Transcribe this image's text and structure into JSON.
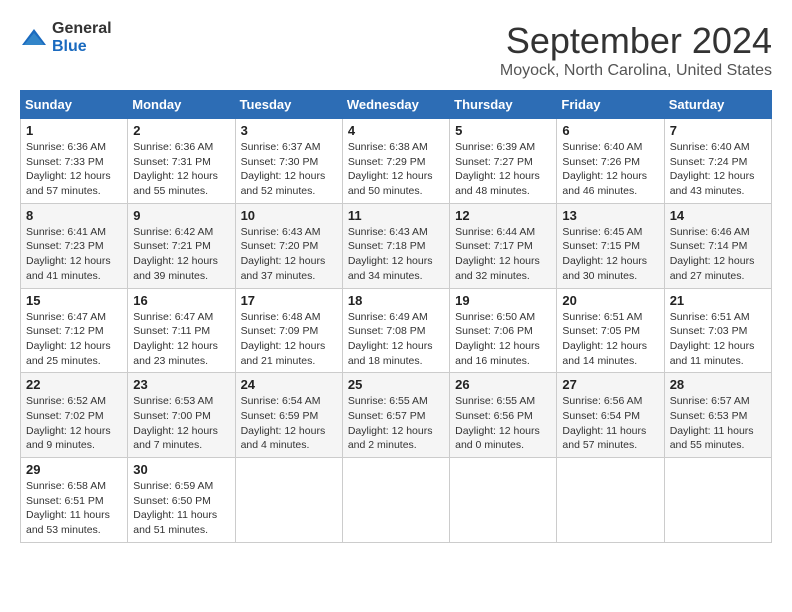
{
  "header": {
    "logo_general": "General",
    "logo_blue": "Blue",
    "month": "September 2024",
    "location": "Moyock, North Carolina, United States"
  },
  "weekdays": [
    "Sunday",
    "Monday",
    "Tuesday",
    "Wednesday",
    "Thursday",
    "Friday",
    "Saturday"
  ],
  "weeks": [
    [
      {
        "day": "1",
        "sunrise": "6:36 AM",
        "sunset": "7:33 PM",
        "daylight": "12 hours and 57 minutes."
      },
      {
        "day": "2",
        "sunrise": "6:36 AM",
        "sunset": "7:31 PM",
        "daylight": "12 hours and 55 minutes."
      },
      {
        "day": "3",
        "sunrise": "6:37 AM",
        "sunset": "7:30 PM",
        "daylight": "12 hours and 52 minutes."
      },
      {
        "day": "4",
        "sunrise": "6:38 AM",
        "sunset": "7:29 PM",
        "daylight": "12 hours and 50 minutes."
      },
      {
        "day": "5",
        "sunrise": "6:39 AM",
        "sunset": "7:27 PM",
        "daylight": "12 hours and 48 minutes."
      },
      {
        "day": "6",
        "sunrise": "6:40 AM",
        "sunset": "7:26 PM",
        "daylight": "12 hours and 46 minutes."
      },
      {
        "day": "7",
        "sunrise": "6:40 AM",
        "sunset": "7:24 PM",
        "daylight": "12 hours and 43 minutes."
      }
    ],
    [
      {
        "day": "8",
        "sunrise": "6:41 AM",
        "sunset": "7:23 PM",
        "daylight": "12 hours and 41 minutes."
      },
      {
        "day": "9",
        "sunrise": "6:42 AM",
        "sunset": "7:21 PM",
        "daylight": "12 hours and 39 minutes."
      },
      {
        "day": "10",
        "sunrise": "6:43 AM",
        "sunset": "7:20 PM",
        "daylight": "12 hours and 37 minutes."
      },
      {
        "day": "11",
        "sunrise": "6:43 AM",
        "sunset": "7:18 PM",
        "daylight": "12 hours and 34 minutes."
      },
      {
        "day": "12",
        "sunrise": "6:44 AM",
        "sunset": "7:17 PM",
        "daylight": "12 hours and 32 minutes."
      },
      {
        "day": "13",
        "sunrise": "6:45 AM",
        "sunset": "7:15 PM",
        "daylight": "12 hours and 30 minutes."
      },
      {
        "day": "14",
        "sunrise": "6:46 AM",
        "sunset": "7:14 PM",
        "daylight": "12 hours and 27 minutes."
      }
    ],
    [
      {
        "day": "15",
        "sunrise": "6:47 AM",
        "sunset": "7:12 PM",
        "daylight": "12 hours and 25 minutes."
      },
      {
        "day": "16",
        "sunrise": "6:47 AM",
        "sunset": "7:11 PM",
        "daylight": "12 hours and 23 minutes."
      },
      {
        "day": "17",
        "sunrise": "6:48 AM",
        "sunset": "7:09 PM",
        "daylight": "12 hours and 21 minutes."
      },
      {
        "day": "18",
        "sunrise": "6:49 AM",
        "sunset": "7:08 PM",
        "daylight": "12 hours and 18 minutes."
      },
      {
        "day": "19",
        "sunrise": "6:50 AM",
        "sunset": "7:06 PM",
        "daylight": "12 hours and 16 minutes."
      },
      {
        "day": "20",
        "sunrise": "6:51 AM",
        "sunset": "7:05 PM",
        "daylight": "12 hours and 14 minutes."
      },
      {
        "day": "21",
        "sunrise": "6:51 AM",
        "sunset": "7:03 PM",
        "daylight": "12 hours and 11 minutes."
      }
    ],
    [
      {
        "day": "22",
        "sunrise": "6:52 AM",
        "sunset": "7:02 PM",
        "daylight": "12 hours and 9 minutes."
      },
      {
        "day": "23",
        "sunrise": "6:53 AM",
        "sunset": "7:00 PM",
        "daylight": "12 hours and 7 minutes."
      },
      {
        "day": "24",
        "sunrise": "6:54 AM",
        "sunset": "6:59 PM",
        "daylight": "12 hours and 4 minutes."
      },
      {
        "day": "25",
        "sunrise": "6:55 AM",
        "sunset": "6:57 PM",
        "daylight": "12 hours and 2 minutes."
      },
      {
        "day": "26",
        "sunrise": "6:55 AM",
        "sunset": "6:56 PM",
        "daylight": "12 hours and 0 minutes."
      },
      {
        "day": "27",
        "sunrise": "6:56 AM",
        "sunset": "6:54 PM",
        "daylight": "11 hours and 57 minutes."
      },
      {
        "day": "28",
        "sunrise": "6:57 AM",
        "sunset": "6:53 PM",
        "daylight": "11 hours and 55 minutes."
      }
    ],
    [
      {
        "day": "29",
        "sunrise": "6:58 AM",
        "sunset": "6:51 PM",
        "daylight": "11 hours and 53 minutes."
      },
      {
        "day": "30",
        "sunrise": "6:59 AM",
        "sunset": "6:50 PM",
        "daylight": "11 hours and 51 minutes."
      },
      null,
      null,
      null,
      null,
      null
    ]
  ]
}
